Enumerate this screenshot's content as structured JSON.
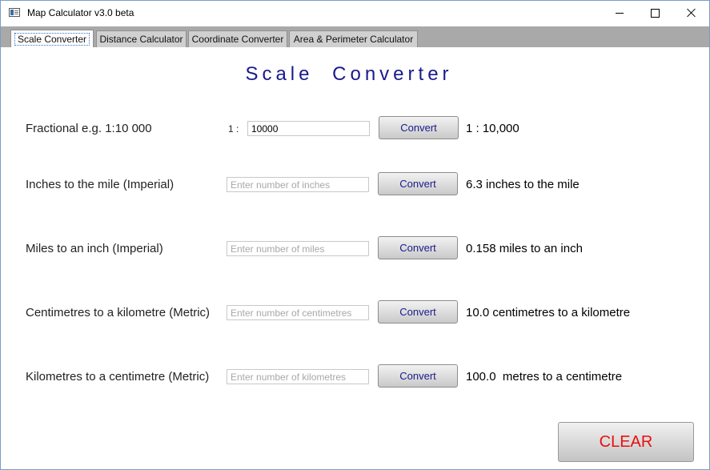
{
  "window": {
    "title": "Map Calculator v3.0 beta",
    "controls": {
      "minimize": "minimize",
      "maximize": "maximize",
      "close": "close"
    }
  },
  "tabs": [
    {
      "label": "Scale Converter",
      "active": true
    },
    {
      "label": "Distance Calculator",
      "active": false
    },
    {
      "label": "Coordinate Converter",
      "active": false
    },
    {
      "label": "Area & Perimeter  Calculator",
      "active": false
    }
  ],
  "page": {
    "title": "Scale  Converter"
  },
  "rows": [
    {
      "label": "Fractional  e.g. 1:10 000",
      "prefix": "1 :",
      "value": "10000",
      "placeholder": "",
      "button": "Convert",
      "result": "1 : 10,000"
    },
    {
      "label": "Inches to the mile (Imperial)",
      "value": "",
      "placeholder": "Enter number of inches",
      "button": "Convert",
      "result": "6.3 inches to the mile"
    },
    {
      "label": "Miles to an inch (Imperial)",
      "value": "",
      "placeholder": "Enter number of miles",
      "button": "Convert",
      "result": "0.158 miles to an inch"
    },
    {
      "label": "Centimetres to a kilometre (Metric)",
      "value": "",
      "placeholder": "Enter number of centimetres",
      "button": "Convert",
      "result": "10.0 centimetres to a kilometre"
    },
    {
      "label": "Kilometres to a centimetre (Metric)",
      "value": "",
      "placeholder": "Enter number of kilometres",
      "button": "Convert",
      "result": "100.0  metres to a centimetre"
    }
  ],
  "clear_button": "CLEAR",
  "colors": {
    "title_blue": "#1a1a8c",
    "clear_red": "#e81010",
    "tabstrip_gray": "#a9a9a9"
  }
}
